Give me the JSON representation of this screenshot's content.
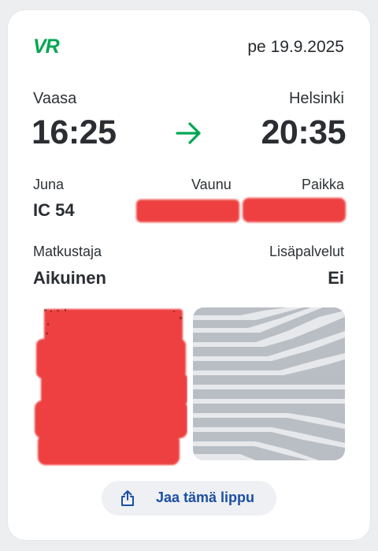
{
  "header": {
    "logo_text": "VR",
    "date": "pe 19.9.2025"
  },
  "route": {
    "from_city": "Vaasa",
    "to_city": "Helsinki",
    "departure": "16:25",
    "arrival": "20:35",
    "arrow_icon": "arrow-right-icon"
  },
  "train": {
    "train_label": "Juna",
    "train_value": "IC 54",
    "car_label": "Vaunu",
    "seat_label": "Paikka"
  },
  "passenger": {
    "label": "Matkustaja",
    "value": "Aikuinen",
    "extras_label": "Lisäpalvelut",
    "extras_value": "Ei"
  },
  "share": {
    "label": "Jaa tämä lippu",
    "icon": "share-icon"
  },
  "colors": {
    "brand_green": "#00a651",
    "link_blue": "#1c4fa5",
    "redaction_red": "#ee4040",
    "pattern_gray": "#b9bec4"
  }
}
